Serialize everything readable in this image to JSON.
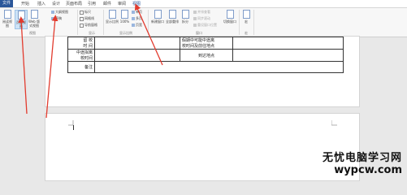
{
  "tabs": [
    "文件",
    "开始",
    "插入",
    "设计",
    "页面布局",
    "引用",
    "邮件",
    "审阅",
    "视图"
  ],
  "active_tab": "视图",
  "ribbon": {
    "views": {
      "buttons": [
        "阅读视图",
        "页面视图",
        "Web 版式视图"
      ],
      "small": [
        "大纲视图",
        "草稿"
      ],
      "group_label": "视图"
    },
    "show": {
      "items": [
        "标尺",
        "网格线",
        "导航窗格"
      ],
      "group_label": "显示"
    },
    "zoom": {
      "buttons": [
        "显示比例",
        "100%"
      ],
      "small": [
        "单页",
        "多页",
        "页宽"
      ],
      "group_label": "显示比例"
    },
    "window": {
      "buttons": [
        "新建窗口",
        "全部重排",
        "拆分"
      ],
      "small": [
        "并排查看",
        "同步滚动",
        "重设窗口位置"
      ],
      "switch": "切换窗口",
      "group_label": "窗口"
    },
    "macros": {
      "button": "宏",
      "group_label": "宏"
    }
  },
  "document": {
    "table": {
      "rows": [
        [
          "留 校\n时 间",
          "",
          "假期中可能中途离\n校时间及前往地点",
          ""
        ],
        [
          "中途拟离\n校时间",
          "",
          "到达地点",
          ""
        ],
        [
          "备注",
          "",
          "",
          ""
        ]
      ]
    }
  },
  "watermark": {
    "line1": "无忧电脑学习网",
    "line2": "wypcw.com"
  },
  "colors": {
    "accent": "#2b579a",
    "arrow": "#e23b2e",
    "selected": "#cde3f7"
  }
}
